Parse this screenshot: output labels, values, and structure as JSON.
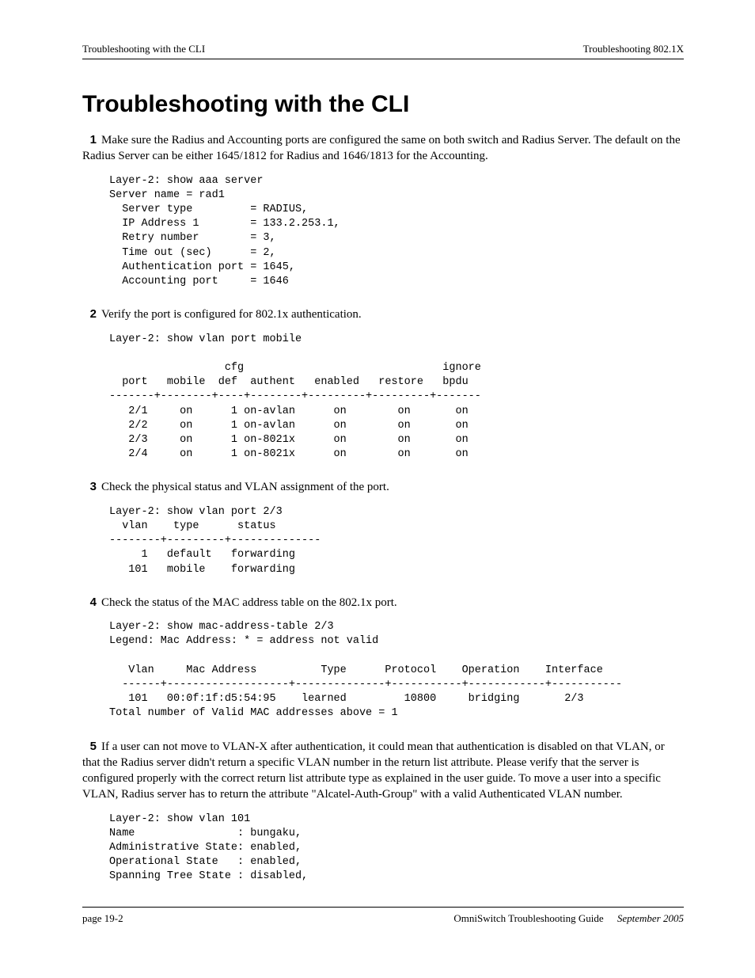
{
  "header": {
    "left": "Troubleshooting with the CLI",
    "right": "Troubleshooting 802.1X"
  },
  "title": "Troubleshooting with the CLI",
  "steps": [
    {
      "num": "1",
      "text": "Make sure the Radius and Accounting ports are configured the same on both switch and Radius Server. The default on the Radius Server can be either 1645/1812 for Radius and 1646/1813 for the Accounting.",
      "code": "Layer-2: show aaa server\nServer name = rad1\n  Server type         = RADIUS,\n  IP Address 1        = 133.2.253.1,\n  Retry number        = 3,\n  Time out (sec)      = 2,\n  Authentication port = 1645,\n  Accounting port     = 1646"
    },
    {
      "num": "2",
      "text": "Verify the port is configured for 802.1x authentication.",
      "code": "Layer-2: show vlan port mobile\n\n                  cfg                               ignore\n  port   mobile  def  authent   enabled   restore   bpdu\n-------+--------+----+--------+---------+---------+-------\n   2/1     on      1 on-avlan      on        on       on\n   2/2     on      1 on-avlan      on        on       on\n   2/3     on      1 on-8021x      on        on       on\n   2/4     on      1 on-8021x      on        on       on"
    },
    {
      "num": "3",
      "text": "Check the physical status and VLAN assignment of the port.",
      "code": "Layer-2: show vlan port 2/3\n  vlan    type      status\n--------+---------+--------------\n     1   default   forwarding\n   101   mobile    forwarding"
    },
    {
      "num": "4",
      "text": "Check the status of the MAC address table on the 802.1x port.",
      "code": "Layer-2: show mac-address-table 2/3\nLegend: Mac Address: * = address not valid\n\n   Vlan     Mac Address          Type      Protocol    Operation    Interface\n  ------+-------------------+--------------+-----------+------------+-----------\n   101   00:0f:1f:d5:54:95    learned         10800     bridging       2/3\nTotal number of Valid MAC addresses above = 1"
    },
    {
      "num": "5",
      "text": "If a user can not move to VLAN-X after authentication, it could mean that authentication is disabled on that VLAN, or that the Radius server didn't return a specific VLAN number in the return list attribute. Please verify that the server is configured properly with the correct return list attribute type as explained in the user guide. To move a user into a specific VLAN, Radius server has to return the attribute \"Alcatel-Auth-Group\" with a valid Authenticated VLAN number.",
      "code": "Layer-2: show vlan 101\nName                : bungaku,\nAdministrative State: enabled,\nOperational State   : enabled,\nSpanning Tree State : disabled,"
    }
  ],
  "footer": {
    "left": "page 19-2",
    "guide": "OmniSwitch Troubleshooting Guide",
    "date": "September 2005"
  }
}
